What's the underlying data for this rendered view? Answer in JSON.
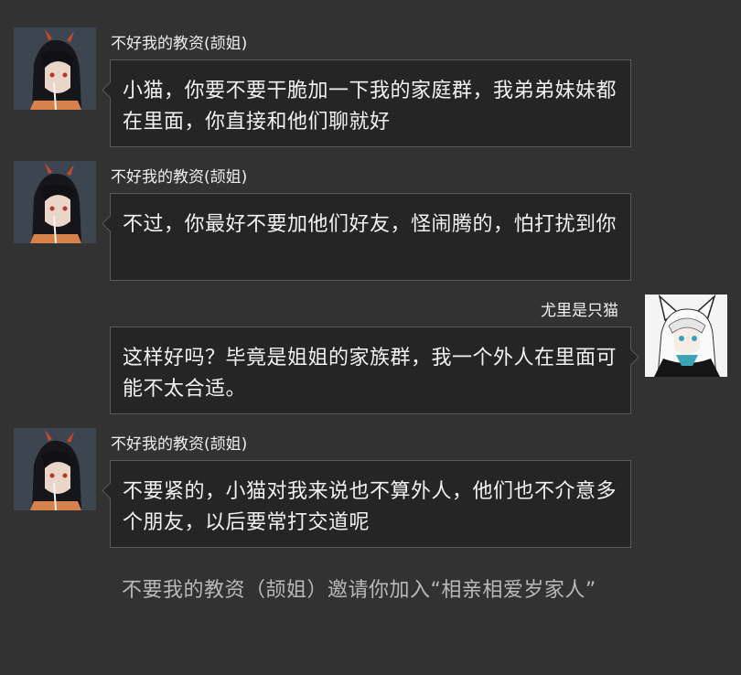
{
  "messages": [
    {
      "sender": "不好我的教资(颉姐)",
      "side": "left",
      "avatar_icon": "dark-haired-horned-girl-avatar",
      "text": "小猫，你要不要干脆加一下我的家庭群，我弟弟妹妹都在里面，你直接和他们聊就好"
    },
    {
      "sender": "不好我的教资(颉姐)",
      "side": "left",
      "avatar_icon": "dark-haired-horned-girl-avatar",
      "text": "不过，你最好不要加他们好友，怪闹腾的，怕打扰到你"
    },
    {
      "sender": "尤里是只猫",
      "side": "right",
      "avatar_icon": "white-haired-cat-eared-girl-avatar",
      "text": "这样好吗？毕竟是姐姐的家族群，我一个外人在里面可能不太合适。"
    },
    {
      "sender": "不好我的教资(颉姐)",
      "side": "left",
      "avatar_icon": "dark-haired-horned-girl-avatar",
      "text": "不要紧的，小猫对我来说也不算外人，他们也不介意多个朋友，以后要常打交道呢"
    }
  ],
  "system_notice": "不要我的教资（颉姐）邀请你加入“相亲相爱岁家人”",
  "colors": {
    "background": "#323232",
    "bubble": "#252525",
    "bubble_border": "#5a5a5a",
    "system_text": "#b9b9b9"
  }
}
